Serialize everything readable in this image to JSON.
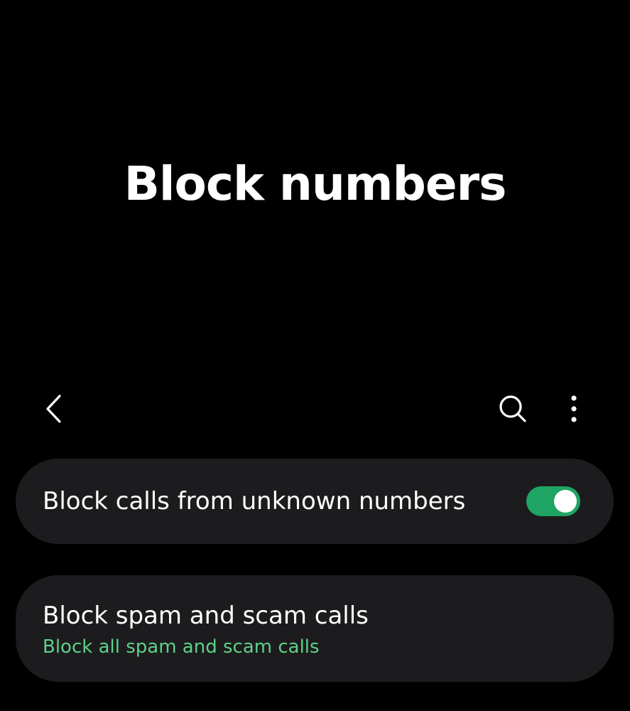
{
  "header": {
    "title": "Block numbers"
  },
  "toolbar": {
    "back_icon": "chevron-left-icon",
    "search_icon": "search-icon",
    "more_icon": "more-vertical-icon"
  },
  "settings": [
    {
      "title": "Block calls from unknown numbers",
      "toggle_on": true
    },
    {
      "title": "Block spam and scam calls",
      "subtitle": "Block all spam and scam calls"
    }
  ],
  "colors": {
    "background": "#000000",
    "card": "#1c1c1e",
    "accent": "#1fa463",
    "subtitle": "#5fd08a",
    "text": "#ffffff"
  }
}
